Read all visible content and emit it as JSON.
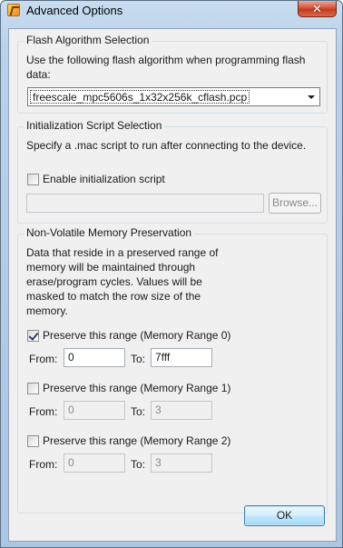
{
  "window": {
    "title": "Advanced Options",
    "close_glyph": "✕"
  },
  "flash": {
    "title": "Flash Algorithm Selection",
    "description": "Use the following flash algorithm when programming flash data:",
    "selected_algorithm": "freescale_mpc5606s_1x32x256k_cflash.pcp"
  },
  "init": {
    "title": "Initialization Script Selection",
    "description": "Specify a .mac script to run after connecting to the device.",
    "checkbox_label": "Enable initialization script",
    "checked": false,
    "script_path": "",
    "browse_label": "Browse..."
  },
  "nvm": {
    "title": "Non-Volatile Memory Preservation",
    "description": "Data that reside in a preserved range of memory will be maintained through erase/program cycles. Values will be masked to match the row size of the memory.",
    "from_label": "From:",
    "to_label": "To:",
    "ranges": [
      {
        "label": "Preserve this range (Memory Range 0)",
        "checked": true,
        "from": "0",
        "to": "7fff"
      },
      {
        "label": "Preserve this range (Memory Range 1)",
        "checked": false,
        "from": "0",
        "to": "3"
      },
      {
        "label": "Preserve this range (Memory Range 2)",
        "checked": false,
        "from": "0",
        "to": "3"
      }
    ]
  },
  "footer": {
    "ok_label": "OK"
  }
}
